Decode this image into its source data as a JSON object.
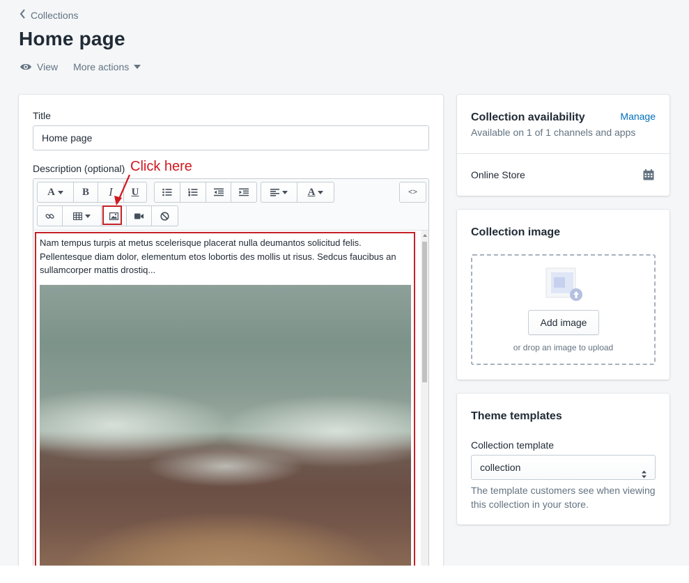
{
  "breadcrumb": {
    "label": "Collections"
  },
  "page": {
    "title": "Home page"
  },
  "actions": {
    "view": "View",
    "more": "More actions"
  },
  "form": {
    "title_label": "Title",
    "title_value": "Home page",
    "description_label": "Description (optional)",
    "description_text": "Nam tempus turpis at metus scelerisque placerat nulla deumantos solicitud felis. Pellentesque diam dolor, elementum etos lobortis des mollis ut risus. Sedcus faucibus an sullamcorper mattis drostiq..."
  },
  "toolbar": {
    "font_glyph": "A",
    "bold": "B",
    "italic": "I",
    "underline": "U",
    "color_glyph": "A",
    "html": "<>"
  },
  "annotation": {
    "text": "Click here",
    "color": "#d0181f"
  },
  "availability": {
    "heading": "Collection availability",
    "manage": "Manage",
    "status": "Available on 1 of 1 channels and apps",
    "channel": "Online Store"
  },
  "collection_image": {
    "heading": "Collection image",
    "button": "Add image",
    "hint": "or drop an image to upload"
  },
  "theme": {
    "heading": "Theme templates",
    "label": "Collection template",
    "selected": "collection",
    "help": "The template customers see when viewing this collection in your store."
  },
  "colors": {
    "link": "#006fbb",
    "highlight": "#c42127",
    "text": "#212b36",
    "subdued": "#637381"
  }
}
